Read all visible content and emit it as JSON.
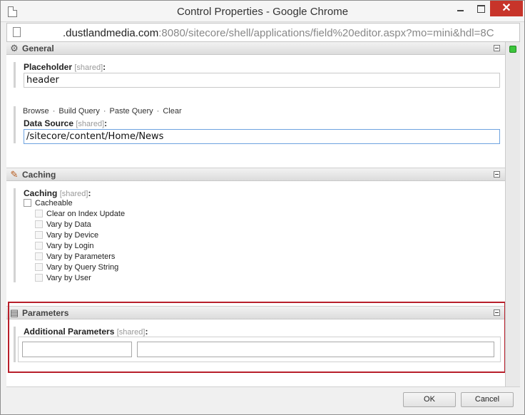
{
  "window": {
    "title": "Control Properties - Google Chrome",
    "close_glyph": "✕"
  },
  "address": {
    "host": ".dustlandmedia.com",
    "rest": ":8080/sitecore/shell/applications/field%20editor.aspx?mo=mini&hdl=8C"
  },
  "sections": {
    "general": {
      "title": "General",
      "icon": "gear-icon",
      "placeholder": {
        "label": "Placeholder",
        "shared": "[shared]",
        "colon": ":",
        "value": "header"
      },
      "links": [
        "Browse",
        "Build Query",
        "Paste Query",
        "Clear"
      ],
      "link_separator": "·",
      "datasource": {
        "label": "Data Source",
        "shared": "[shared]",
        "colon": ":",
        "value": "/sitecore/content/Home/News"
      }
    },
    "caching": {
      "title": "Caching",
      "icon": "caching-icon",
      "label": "Caching",
      "shared": "[shared]",
      "colon": ":",
      "cacheable": "Cacheable",
      "options": [
        "Clear on Index Update",
        "Vary by Data",
        "Vary by Device",
        "Vary by Login",
        "Vary by Parameters",
        "Vary by Query String",
        "Vary by User"
      ]
    },
    "parameters": {
      "title": "Parameters",
      "icon": "parameters-icon",
      "label": "Additional Parameters",
      "shared": "[shared]",
      "colon": ":",
      "key_value": "",
      "value_value": ""
    }
  },
  "buttons": {
    "ok": "OK",
    "cancel": "Cancel"
  },
  "colors": {
    "highlight": "#b81f2b",
    "close": "#c7342a",
    "status": "#3cc53c"
  }
}
